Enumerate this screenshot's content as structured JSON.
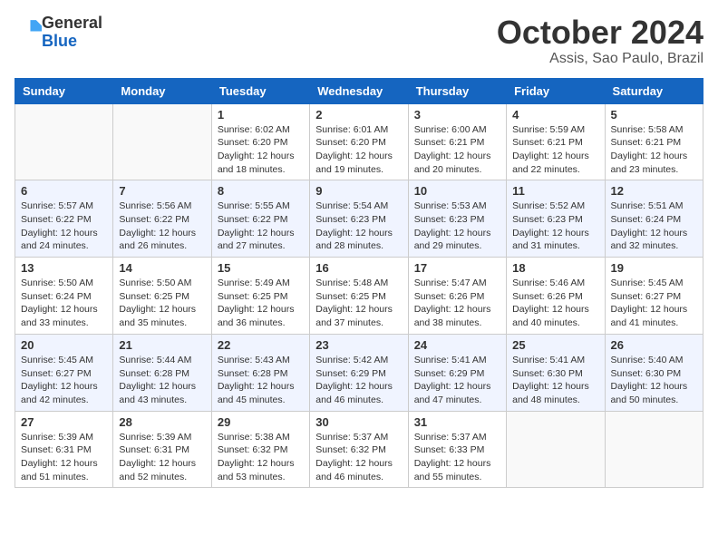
{
  "header": {
    "logo": {
      "line1": "General",
      "line2": "Blue"
    },
    "title": "October 2024",
    "location": "Assis, Sao Paulo, Brazil"
  },
  "weekdays": [
    "Sunday",
    "Monday",
    "Tuesday",
    "Wednesday",
    "Thursday",
    "Friday",
    "Saturday"
  ],
  "weeks": [
    [
      {
        "day": "",
        "info": ""
      },
      {
        "day": "",
        "info": ""
      },
      {
        "day": "1",
        "info": "Sunrise: 6:02 AM\nSunset: 6:20 PM\nDaylight: 12 hours and 18 minutes."
      },
      {
        "day": "2",
        "info": "Sunrise: 6:01 AM\nSunset: 6:20 PM\nDaylight: 12 hours and 19 minutes."
      },
      {
        "day": "3",
        "info": "Sunrise: 6:00 AM\nSunset: 6:21 PM\nDaylight: 12 hours and 20 minutes."
      },
      {
        "day": "4",
        "info": "Sunrise: 5:59 AM\nSunset: 6:21 PM\nDaylight: 12 hours and 22 minutes."
      },
      {
        "day": "5",
        "info": "Sunrise: 5:58 AM\nSunset: 6:21 PM\nDaylight: 12 hours and 23 minutes."
      }
    ],
    [
      {
        "day": "6",
        "info": "Sunrise: 5:57 AM\nSunset: 6:22 PM\nDaylight: 12 hours and 24 minutes."
      },
      {
        "day": "7",
        "info": "Sunrise: 5:56 AM\nSunset: 6:22 PM\nDaylight: 12 hours and 26 minutes."
      },
      {
        "day": "8",
        "info": "Sunrise: 5:55 AM\nSunset: 6:22 PM\nDaylight: 12 hours and 27 minutes."
      },
      {
        "day": "9",
        "info": "Sunrise: 5:54 AM\nSunset: 6:23 PM\nDaylight: 12 hours and 28 minutes."
      },
      {
        "day": "10",
        "info": "Sunrise: 5:53 AM\nSunset: 6:23 PM\nDaylight: 12 hours and 29 minutes."
      },
      {
        "day": "11",
        "info": "Sunrise: 5:52 AM\nSunset: 6:23 PM\nDaylight: 12 hours and 31 minutes."
      },
      {
        "day": "12",
        "info": "Sunrise: 5:51 AM\nSunset: 6:24 PM\nDaylight: 12 hours and 32 minutes."
      }
    ],
    [
      {
        "day": "13",
        "info": "Sunrise: 5:50 AM\nSunset: 6:24 PM\nDaylight: 12 hours and 33 minutes."
      },
      {
        "day": "14",
        "info": "Sunrise: 5:50 AM\nSunset: 6:25 PM\nDaylight: 12 hours and 35 minutes."
      },
      {
        "day": "15",
        "info": "Sunrise: 5:49 AM\nSunset: 6:25 PM\nDaylight: 12 hours and 36 minutes."
      },
      {
        "day": "16",
        "info": "Sunrise: 5:48 AM\nSunset: 6:25 PM\nDaylight: 12 hours and 37 minutes."
      },
      {
        "day": "17",
        "info": "Sunrise: 5:47 AM\nSunset: 6:26 PM\nDaylight: 12 hours and 38 minutes."
      },
      {
        "day": "18",
        "info": "Sunrise: 5:46 AM\nSunset: 6:26 PM\nDaylight: 12 hours and 40 minutes."
      },
      {
        "day": "19",
        "info": "Sunrise: 5:45 AM\nSunset: 6:27 PM\nDaylight: 12 hours and 41 minutes."
      }
    ],
    [
      {
        "day": "20",
        "info": "Sunrise: 5:45 AM\nSunset: 6:27 PM\nDaylight: 12 hours and 42 minutes."
      },
      {
        "day": "21",
        "info": "Sunrise: 5:44 AM\nSunset: 6:28 PM\nDaylight: 12 hours and 43 minutes."
      },
      {
        "day": "22",
        "info": "Sunrise: 5:43 AM\nSunset: 6:28 PM\nDaylight: 12 hours and 45 minutes."
      },
      {
        "day": "23",
        "info": "Sunrise: 5:42 AM\nSunset: 6:29 PM\nDaylight: 12 hours and 46 minutes."
      },
      {
        "day": "24",
        "info": "Sunrise: 5:41 AM\nSunset: 6:29 PM\nDaylight: 12 hours and 47 minutes."
      },
      {
        "day": "25",
        "info": "Sunrise: 5:41 AM\nSunset: 6:30 PM\nDaylight: 12 hours and 48 minutes."
      },
      {
        "day": "26",
        "info": "Sunrise: 5:40 AM\nSunset: 6:30 PM\nDaylight: 12 hours and 50 minutes."
      }
    ],
    [
      {
        "day": "27",
        "info": "Sunrise: 5:39 AM\nSunset: 6:31 PM\nDaylight: 12 hours and 51 minutes."
      },
      {
        "day": "28",
        "info": "Sunrise: 5:39 AM\nSunset: 6:31 PM\nDaylight: 12 hours and 52 minutes."
      },
      {
        "day": "29",
        "info": "Sunrise: 5:38 AM\nSunset: 6:32 PM\nDaylight: 12 hours and 53 minutes."
      },
      {
        "day": "30",
        "info": "Sunrise: 5:37 AM\nSunset: 6:32 PM\nDaylight: 12 hours and 46 minutes."
      },
      {
        "day": "31",
        "info": "Sunrise: 5:37 AM\nSunset: 6:33 PM\nDaylight: 12 hours and 55 minutes."
      },
      {
        "day": "",
        "info": ""
      },
      {
        "day": "",
        "info": ""
      }
    ]
  ]
}
